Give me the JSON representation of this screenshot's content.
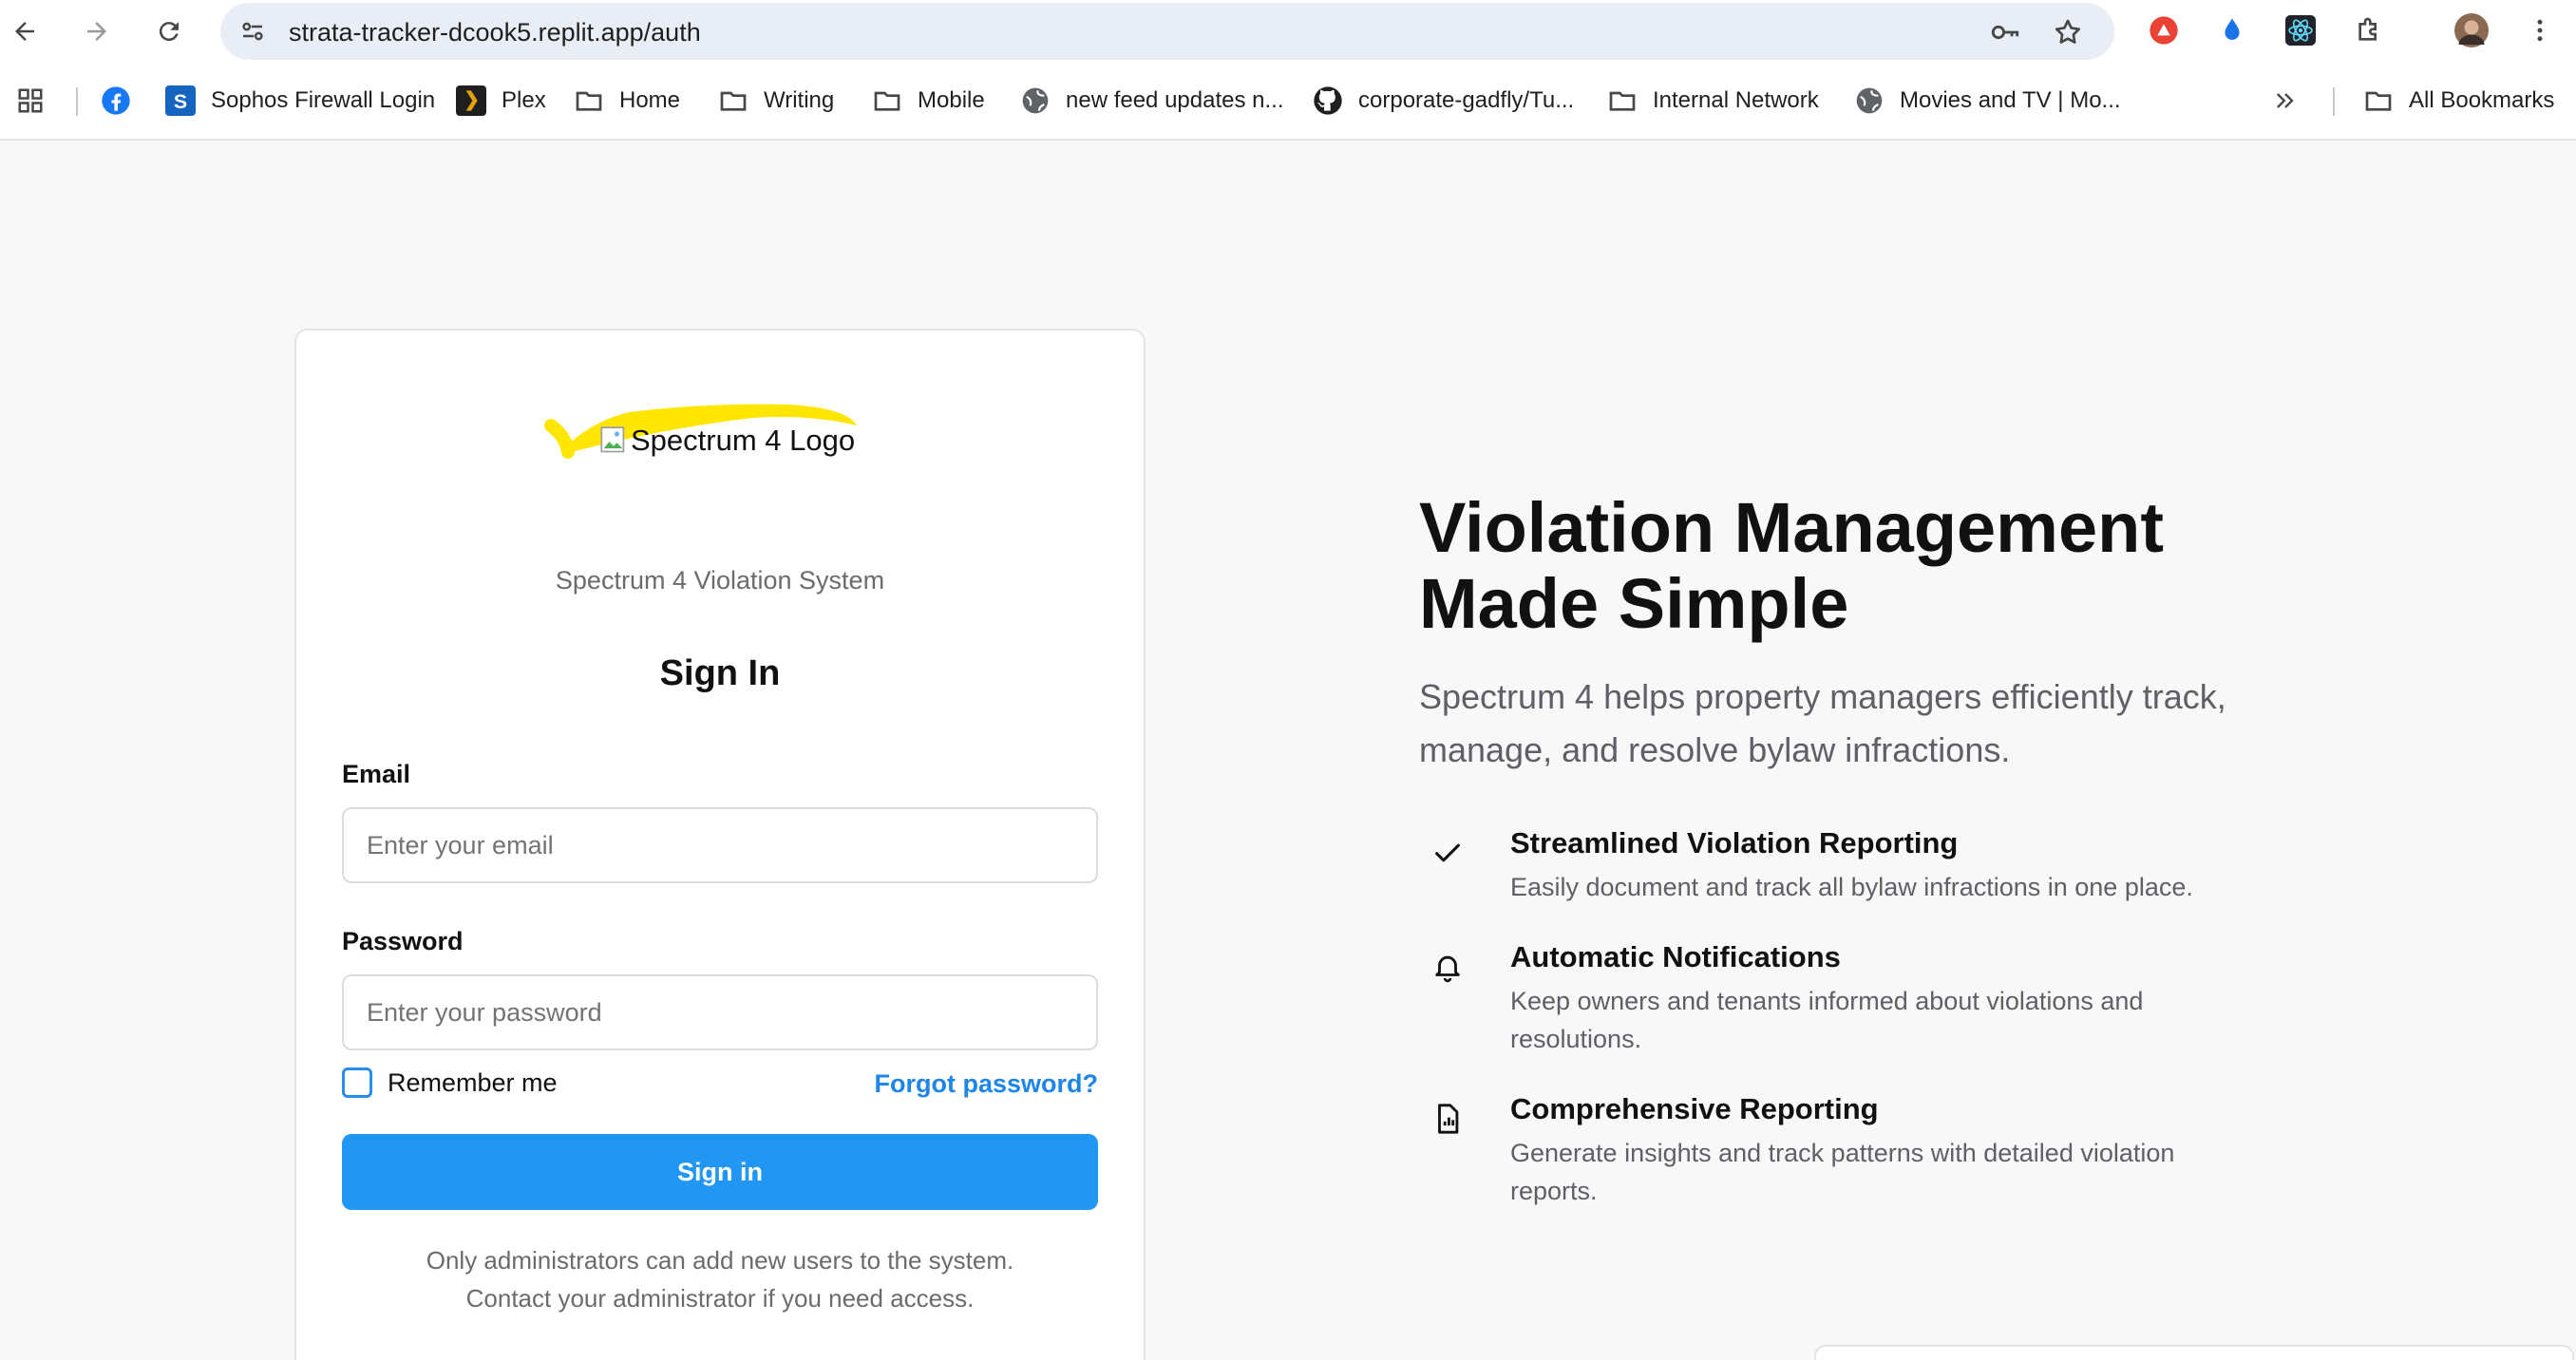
{
  "browser": {
    "url": "strata-tracker-dcook5.replit.app/auth",
    "bookmarks": [
      {
        "label": "Sophos Firewall Login",
        "icon": "sophos-icon"
      },
      {
        "label": "Plex",
        "icon": "plex-icon"
      },
      {
        "label": "Home",
        "icon": "folder-icon"
      },
      {
        "label": "Writing",
        "icon": "folder-icon"
      },
      {
        "label": "Mobile",
        "icon": "folder-icon"
      },
      {
        "label": "new feed updates n...",
        "icon": "globe-icon"
      },
      {
        "label": "corporate-gadfly/Tu...",
        "icon": "github-icon"
      },
      {
        "label": "Internal Network",
        "icon": "folder-icon"
      },
      {
        "label": "Movies and TV | Mo...",
        "icon": "globe-icon"
      }
    ],
    "all_bookmarks": "All Bookmarks",
    "accent": "#1a73e8"
  },
  "login": {
    "logo_alt": "Spectrum 4 Logo",
    "system_title": "Spectrum 4 Violation System",
    "heading": "Sign In",
    "email_label": "Email",
    "email_placeholder": "Enter your email",
    "password_label": "Password",
    "password_placeholder": "Enter your password",
    "remember_label": "Remember me",
    "forgot_label": "Forgot password?",
    "submit_label": "Sign in",
    "note_line1": "Only administrators can add new users to the system.",
    "note_line2": "Contact your administrator if you need access.",
    "button_color": "#2196f3",
    "highlight_color": "#ffe600"
  },
  "hero": {
    "title_line1": "Violation Management",
    "title_line2": "Made Simple",
    "subtitle": "Spectrum 4 helps property managers efficiently track, manage, and resolve bylaw infractions.",
    "features": [
      {
        "icon": "check-icon",
        "title": "Streamlined Violation Reporting",
        "text": "Easily document and track all bylaw infractions in one place."
      },
      {
        "icon": "bell-icon",
        "title": "Automatic Notifications",
        "text": "Keep owners and tenants informed about violations and resolutions."
      },
      {
        "icon": "report-icon",
        "title": "Comprehensive Reporting",
        "text": "Generate insights and track patterns with detailed violation reports."
      }
    ]
  }
}
